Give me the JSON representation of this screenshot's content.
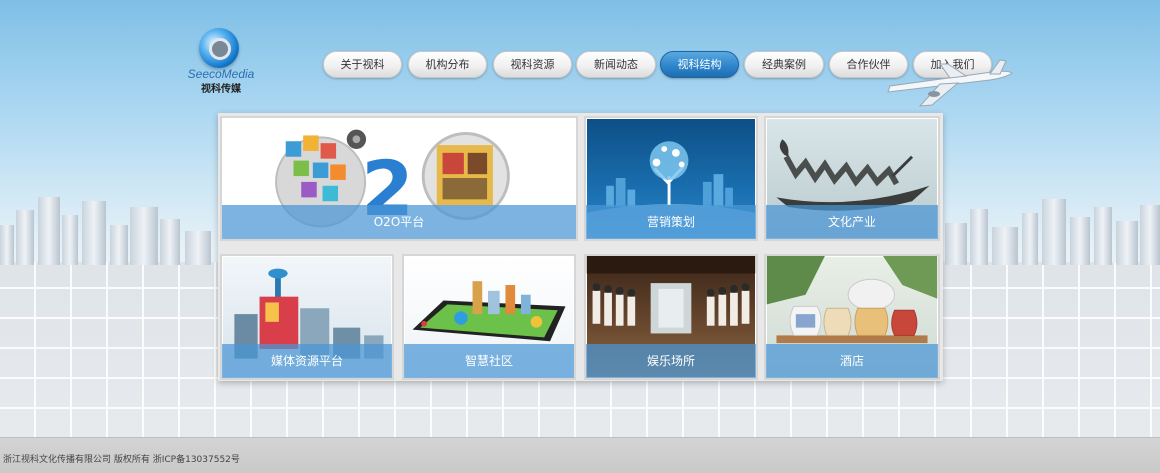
{
  "logo": {
    "name_en": "SeecoMedia",
    "name_cn": "视科传媒"
  },
  "nav": {
    "items": [
      {
        "label": "关于视科"
      },
      {
        "label": "机构分布"
      },
      {
        "label": "视科资源"
      },
      {
        "label": "新闻动态"
      },
      {
        "label": "视科结构",
        "active": true
      },
      {
        "label": "经典案例"
      },
      {
        "label": "合作伙伴"
      },
      {
        "label": "加入我们"
      }
    ]
  },
  "tiles": [
    {
      "label": "O2O平台",
      "icon": "o2o-graphic"
    },
    {
      "label": "营销策划",
      "icon": "tree-graphic"
    },
    {
      "label": "文化产业",
      "icon": "dragon-boat-sculpture"
    },
    {
      "label": "媒体资源平台",
      "icon": "tower-building"
    },
    {
      "label": "智慧社区",
      "icon": "tablet-city"
    },
    {
      "label": "娱乐场所",
      "icon": "hotel-staff-lobby"
    },
    {
      "label": "酒店",
      "icon": "porcelain-jars"
    }
  ],
  "footer": {
    "copyright": "浙江视科文化传播有限公司 版权所有 浙ICP备13037552号"
  },
  "colors": {
    "sky_top": "#7fbfe6",
    "nav_active": "#2f86cc",
    "caption_bar": "#4a96d6",
    "footer_bg": "#cfcfcf"
  }
}
